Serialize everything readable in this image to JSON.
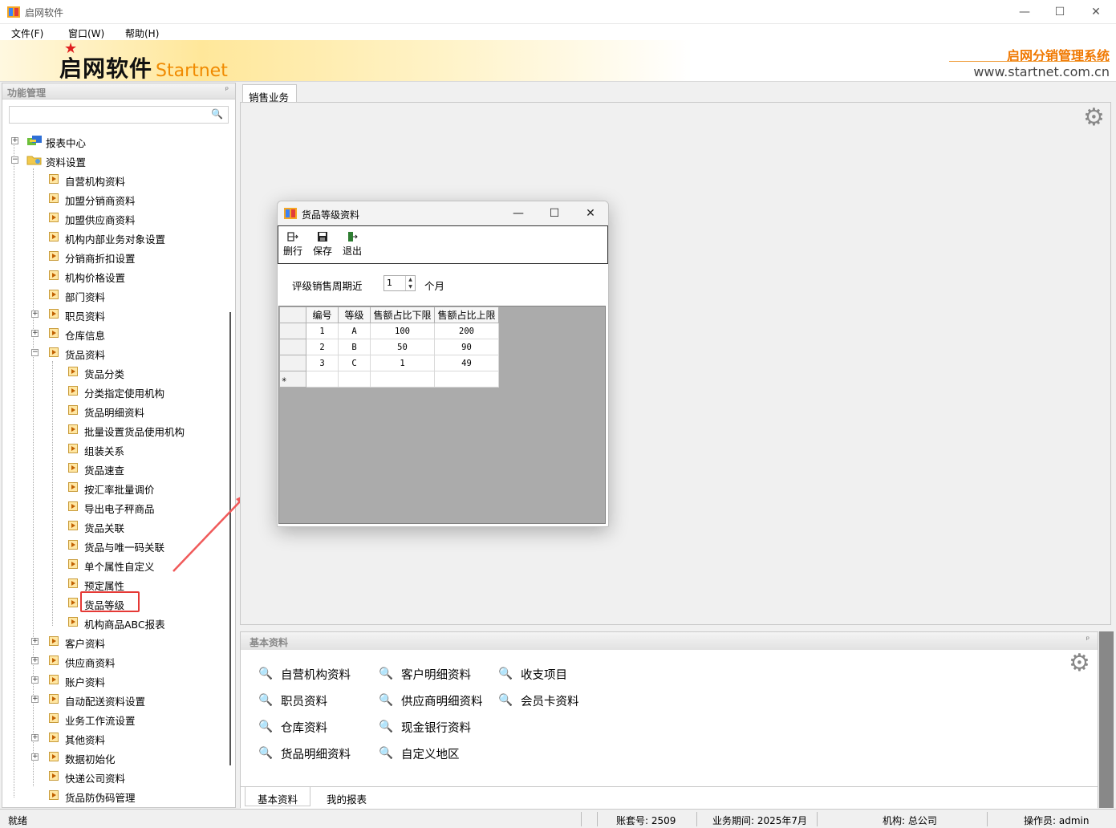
{
  "window": {
    "title": "启网软件",
    "minimize": "—",
    "maximize": "☐",
    "close": "✕"
  },
  "menu": [
    "文件(F)",
    "窗口(W)",
    "帮助(H)"
  ],
  "banner": {
    "logo_cn": "启网软件",
    "logo_en": "Startnet",
    "system_name": "启网分销管理系统",
    "url": "www.startnet.com.cn"
  },
  "left_panel": {
    "title": "功能管理",
    "pin": "ᵖ",
    "search_value": "",
    "tree": {
      "report_center": "报表中心",
      "data_settings": "资料设置",
      "items": [
        "自营机构资料",
        "加盟分销商资料",
        "加盟供应商资料",
        "机构内部业务对象设置",
        "分销商折扣设置",
        "机构价格设置",
        "部门资料",
        "职员资料",
        "仓库信息",
        "货品资料"
      ],
      "goods_children": [
        "货品分类",
        "分类指定使用机构",
        "货品明细资料",
        "批量设置货品使用机构",
        "组装关系",
        "货品速查",
        "按汇率批量调价",
        "导出电子秤商品",
        "货品关联",
        "货品与唯一码关联",
        "单个属性自定义",
        "预定属性",
        "货品等级",
        "机构商品ABC报表"
      ],
      "after_items": [
        "客户资料",
        "供应商资料",
        "账户资料",
        "自动配送资料设置",
        "业务工作流设置",
        "其他资料",
        "数据初始化",
        "快递公司资料",
        "货品防伪码管理"
      ]
    }
  },
  "main_tab": "销售业务",
  "dialog": {
    "title": "货品等级资料",
    "toolbar": {
      "delete_row": "删行",
      "save": "保存",
      "exit": "退出"
    },
    "period_label": "评级销售周期近",
    "period_value": "1",
    "period_unit": "个月",
    "grid": {
      "headers": [
        "编号",
        "等级",
        "售额占比下限",
        "售额占比上限"
      ],
      "rows": [
        [
          "1",
          "A",
          "100",
          "200"
        ],
        [
          "2",
          "B",
          "50",
          "90"
        ],
        [
          "3",
          "C",
          "1",
          "49"
        ]
      ],
      "new_row_marker": "✳"
    }
  },
  "bottom_panel": {
    "title": "基本资料",
    "links": [
      "自营机构资料",
      "客户明细资料",
      "收支项目",
      "职员资料",
      "供应商明细资料",
      "会员卡资料",
      "仓库资料",
      "现金银行资料",
      "货品明细资料",
      "自定义地区"
    ],
    "tabs": [
      "基本资料",
      "我的报表"
    ]
  },
  "status": {
    "state": "就绪",
    "account": "账套号: 2509",
    "period": "业务期间: 2025年7月",
    "org": "机构: 总公司",
    "operator": "操作员: admin"
  },
  "colors": {
    "accent_orange": "#f07800",
    "highlight_red": "#e53935",
    "grid_bg": "#ababab"
  }
}
